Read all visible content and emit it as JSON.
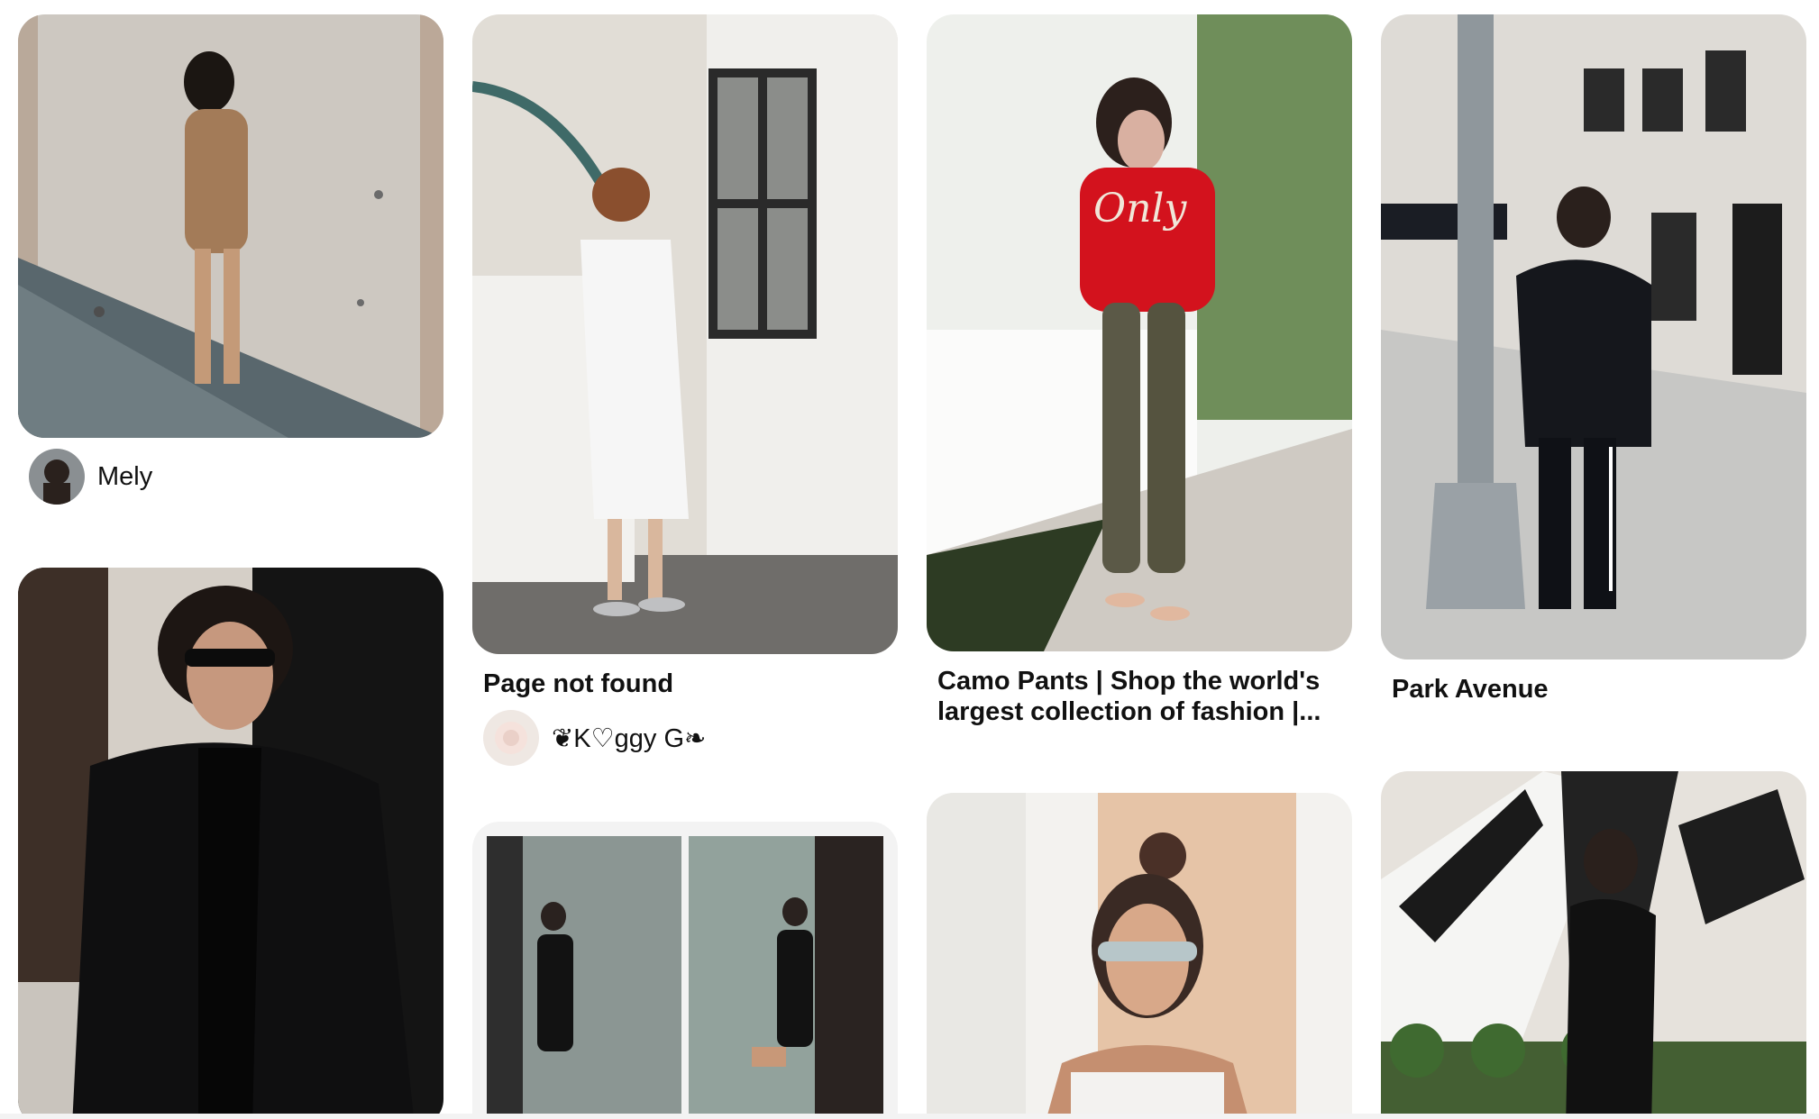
{
  "pins": [
    {
      "id": "pin-1",
      "image_alt": "Woman in tan suede dress against concrete wall",
      "title": "",
      "author": "Mely",
      "image_colors": [
        "#cfcac3",
        "#a37b58",
        "#4b5a60"
      ]
    },
    {
      "id": "pin-2",
      "image_alt": "Fur coat and sunglasses portrait",
      "title": "",
      "author": "",
      "image_colors": [
        "#151515",
        "#2c2c2c",
        "#d9d4cd"
      ]
    },
    {
      "id": "pin-3",
      "image_alt": "White dress with silver heels by white building",
      "title": "Page not found",
      "author": "❦K♡ggy G❧",
      "image_colors": [
        "#dedad4",
        "#f4f4f4",
        "#6e6c69"
      ]
    },
    {
      "id": "pin-4",
      "image_alt": "Collage: black jumpsuit outfit",
      "title": "",
      "author": "",
      "image_colors": [
        "#8c9895",
        "#1a1a1a",
        "#c6c1b9"
      ]
    },
    {
      "id": "pin-5",
      "image_alt": "Red Only sweater with camo pants",
      "title": "Camo Pants | Shop the world's largest collection of fashion |...",
      "author": "",
      "image_colors": [
        "#f1f1ef",
        "#d3121d",
        "#5c5a4a"
      ]
    },
    {
      "id": "pin-6",
      "image_alt": "Top knot and sunglasses portrait",
      "title": "",
      "author": "",
      "image_colors": [
        "#e7c5a9",
        "#f5f5f3",
        "#3a2a24"
      ]
    },
    {
      "id": "pin-7",
      "image_alt": "Black fur jacket on Park Avenue",
      "title": "Park Avenue",
      "author": "",
      "image_colors": [
        "#d9d6d1",
        "#1b1d24",
        "#8e969c"
      ]
    },
    {
      "id": "pin-8",
      "image_alt": "Leather jacket against mural",
      "title": "",
      "author": "",
      "image_colors": [
        "#e8e4de",
        "#111111",
        "#4f7a3a"
      ]
    }
  ]
}
